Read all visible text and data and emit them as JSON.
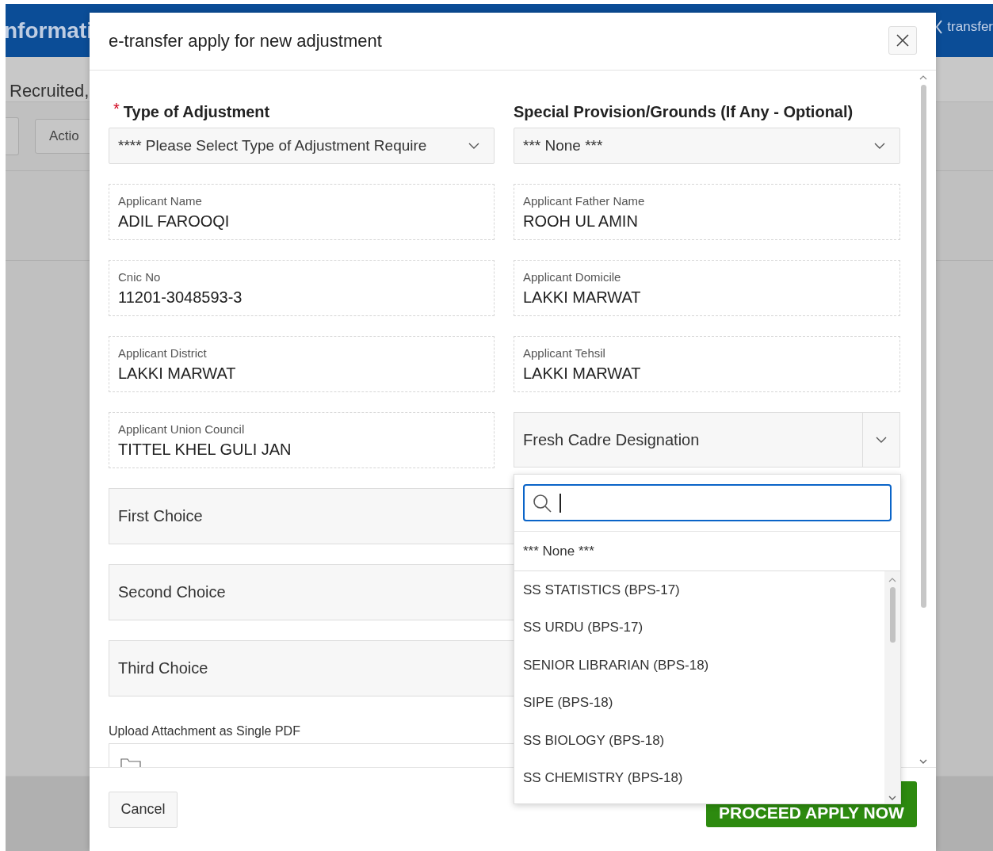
{
  "background_page": {
    "header_title": "nformati",
    "header_link": "transfer",
    "heading": "Recruited,",
    "toolbar_button": "Actio"
  },
  "dialog": {
    "title": "e-transfer apply for new adjustment",
    "fields": [
      {
        "kind": "select",
        "required_mark": "*",
        "label": "Type of Adjustment",
        "value": "**** Please Select Type of Adjustment Require"
      },
      {
        "kind": "select",
        "label": "Special Provision/Grounds (If Any - Optional)",
        "value": "*** None ***"
      },
      {
        "kind": "display",
        "label": "Applicant Name",
        "value": "ADIL FAROOQI"
      },
      {
        "kind": "display",
        "label": "Applicant Father Name",
        "value": "ROOH UL AMIN"
      },
      {
        "kind": "display",
        "label": "Cnic No",
        "value": "11201-3048593-3"
      },
      {
        "kind": "display",
        "label": "Applicant Domicile",
        "value": "LAKKI MARWAT"
      },
      {
        "kind": "display",
        "label": "Applicant District",
        "value": "LAKKI MARWAT"
      },
      {
        "kind": "display",
        "label": "Applicant Tehsil",
        "value": "LAKKI MARWAT"
      },
      {
        "kind": "display",
        "label": "Applicant Union Council",
        "value": "TITTEL KHEL GULI JAN"
      },
      {
        "kind": "popup",
        "value": "Fresh Cadre Designation"
      },
      {
        "kind": "choice",
        "value": "First Choice"
      },
      {
        "kind": "choice",
        "value": "Second Choice"
      },
      {
        "kind": "choice",
        "value": "Third Choice"
      },
      {
        "kind": "file",
        "label": "Upload Attachment as Single PDF"
      }
    ],
    "dropdown": {
      "pinned_option": "*** None ***",
      "options": [
        "SS STATISTICS (BPS-17)",
        "SS URDU (BPS-17)",
        "SENIOR LIBRARIAN (BPS-18)",
        "SIPE (BPS-18)",
        "SS BIOLOGY (BPS-18)",
        "SS CHEMISTRY (BPS-18)"
      ]
    },
    "footer": {
      "cancel": "Cancel",
      "proceed": "PROCEED APPLY NOW"
    }
  }
}
